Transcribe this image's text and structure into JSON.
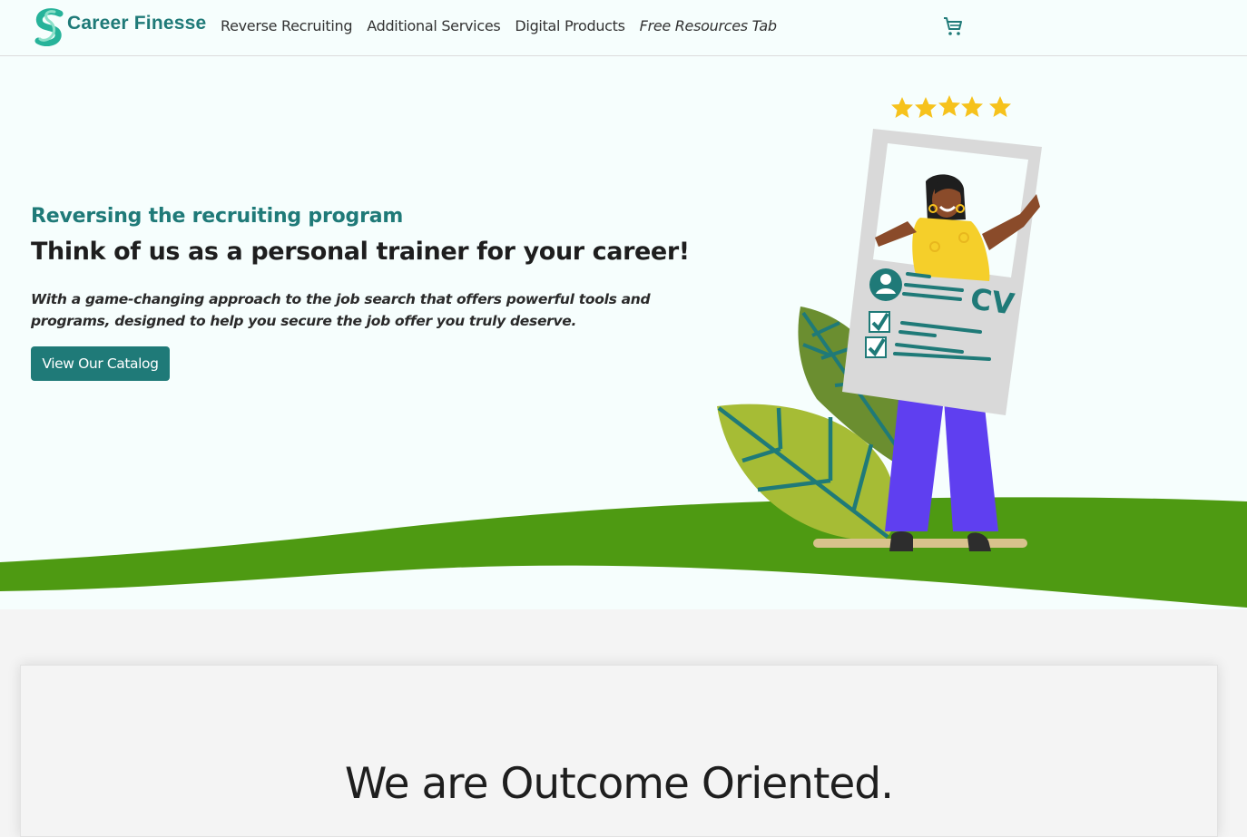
{
  "brand": {
    "name": "Career Finesse",
    "logo_icon": "career-finesse-logo-icon"
  },
  "nav": {
    "links": [
      {
        "label": "Reverse Recruiting"
      },
      {
        "label": "Additional Services"
      },
      {
        "label": "Digital Products"
      },
      {
        "label": "Free Resources Tab"
      }
    ],
    "cart_icon": "shopping-cart-icon"
  },
  "hero": {
    "eyebrow": "Reversing the recruiting program",
    "headline": "Think of us as a personal trainer for your career!",
    "description": "With a game-changing approach to the job search that offers powerful tools and programs, designed to help you secure the job offer you truly deserve.",
    "cta_label": "View Our Catalog",
    "illustration": {
      "cv_text": "CV",
      "star_rating": 5
    }
  },
  "outcome": {
    "title": "We are Outcome Oriented."
  },
  "colors": {
    "accent": "#1f7a78",
    "hill": "#4e9a12",
    "hero_bg": "#f6fefd",
    "page_bg": "#f4f4f4",
    "star": "#f6c21c",
    "pants": "#5f3ff0"
  }
}
